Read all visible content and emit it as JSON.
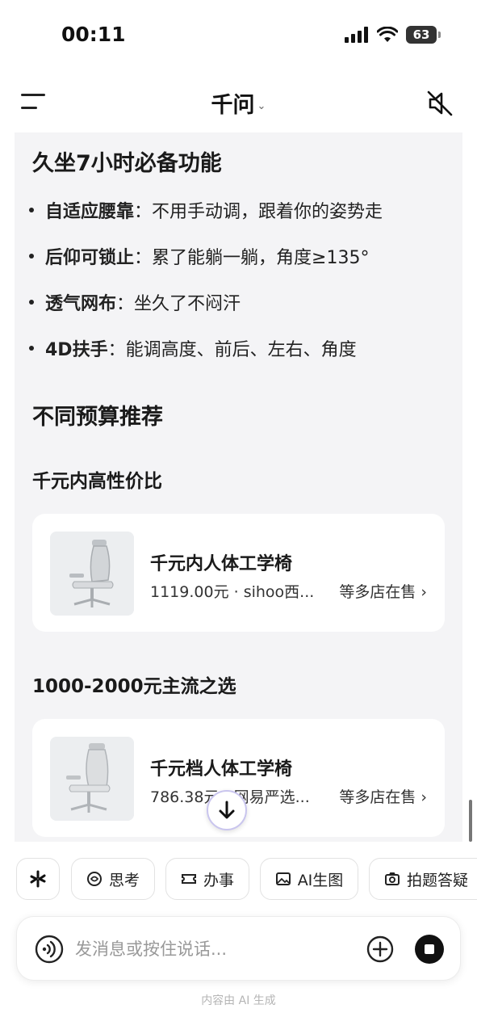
{
  "status_bar": {
    "time": "00:11",
    "battery": "63"
  },
  "header": {
    "title": "千问",
    "title_chevron": "⌄"
  },
  "content": {
    "section_features": {
      "heading": "久坐7小时必备功能",
      "items": [
        {
          "label": "自适应腰靠",
          "text": "：不用手动调，跟着你的姿势走"
        },
        {
          "label": "后仰可锁止",
          "text": "：累了能躺一躺，角度≥135°"
        },
        {
          "label": "透气网布",
          "text": "：坐久了不闷汗"
        },
        {
          "label": "4D扶手",
          "text": "：能调高度、前后、左右、角度"
        }
      ]
    },
    "section_budget": {
      "heading": "不同预算推荐",
      "groups": [
        {
          "title": "千元内高性价比",
          "product": {
            "name": "千元内人体工学椅",
            "price": "1119.00元",
            "seller": "sihoo西...",
            "stores": "等多店在售 ›"
          }
        },
        {
          "title": "1000-2000元主流之选",
          "product": {
            "name": "千元档人体工学椅",
            "price": "786.38元",
            "seller": "网易严选...",
            "stores": "等多店在售 ›"
          }
        }
      ]
    }
  },
  "chips": [
    {
      "label": "",
      "icon": "spark-icon"
    },
    {
      "label": "思考",
      "icon": "think-icon"
    },
    {
      "label": "办事",
      "icon": "ticket-icon"
    },
    {
      "label": "AI生图",
      "icon": "image-icon"
    },
    {
      "label": "拍题答疑",
      "icon": "camera-icon"
    }
  ],
  "input": {
    "placeholder": "发消息或按住说话..."
  },
  "footer": {
    "note": "内容由 AI 生成"
  }
}
